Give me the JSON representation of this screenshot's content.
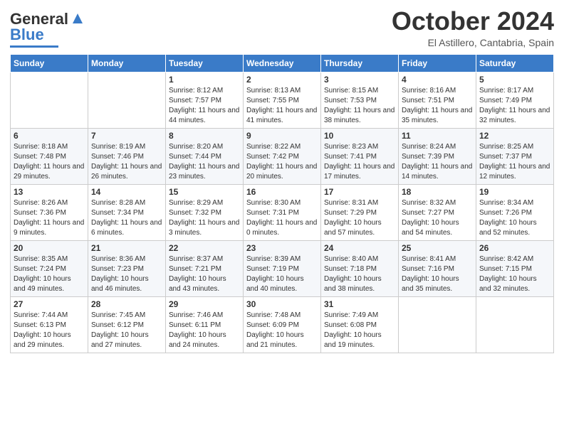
{
  "logo": {
    "line1": "General",
    "line2": "Blue"
  },
  "header": {
    "month": "October 2024",
    "location": "El Astillero, Cantabria, Spain"
  },
  "weekdays": [
    "Sunday",
    "Monday",
    "Tuesday",
    "Wednesday",
    "Thursday",
    "Friday",
    "Saturday"
  ],
  "weeks": [
    [
      {
        "day": "",
        "sunrise": "",
        "sunset": "",
        "daylight": ""
      },
      {
        "day": "",
        "sunrise": "",
        "sunset": "",
        "daylight": ""
      },
      {
        "day": "1",
        "sunrise": "Sunrise: 8:12 AM",
        "sunset": "Sunset: 7:57 PM",
        "daylight": "Daylight: 11 hours and 44 minutes."
      },
      {
        "day": "2",
        "sunrise": "Sunrise: 8:13 AM",
        "sunset": "Sunset: 7:55 PM",
        "daylight": "Daylight: 11 hours and 41 minutes."
      },
      {
        "day": "3",
        "sunrise": "Sunrise: 8:15 AM",
        "sunset": "Sunset: 7:53 PM",
        "daylight": "Daylight: 11 hours and 38 minutes."
      },
      {
        "day": "4",
        "sunrise": "Sunrise: 8:16 AM",
        "sunset": "Sunset: 7:51 PM",
        "daylight": "Daylight: 11 hours and 35 minutes."
      },
      {
        "day": "5",
        "sunrise": "Sunrise: 8:17 AM",
        "sunset": "Sunset: 7:49 PM",
        "daylight": "Daylight: 11 hours and 32 minutes."
      }
    ],
    [
      {
        "day": "6",
        "sunrise": "Sunrise: 8:18 AM",
        "sunset": "Sunset: 7:48 PM",
        "daylight": "Daylight: 11 hours and 29 minutes."
      },
      {
        "day": "7",
        "sunrise": "Sunrise: 8:19 AM",
        "sunset": "Sunset: 7:46 PM",
        "daylight": "Daylight: 11 hours and 26 minutes."
      },
      {
        "day": "8",
        "sunrise": "Sunrise: 8:20 AM",
        "sunset": "Sunset: 7:44 PM",
        "daylight": "Daylight: 11 hours and 23 minutes."
      },
      {
        "day": "9",
        "sunrise": "Sunrise: 8:22 AM",
        "sunset": "Sunset: 7:42 PM",
        "daylight": "Daylight: 11 hours and 20 minutes."
      },
      {
        "day": "10",
        "sunrise": "Sunrise: 8:23 AM",
        "sunset": "Sunset: 7:41 PM",
        "daylight": "Daylight: 11 hours and 17 minutes."
      },
      {
        "day": "11",
        "sunrise": "Sunrise: 8:24 AM",
        "sunset": "Sunset: 7:39 PM",
        "daylight": "Daylight: 11 hours and 14 minutes."
      },
      {
        "day": "12",
        "sunrise": "Sunrise: 8:25 AM",
        "sunset": "Sunset: 7:37 PM",
        "daylight": "Daylight: 11 hours and 12 minutes."
      }
    ],
    [
      {
        "day": "13",
        "sunrise": "Sunrise: 8:26 AM",
        "sunset": "Sunset: 7:36 PM",
        "daylight": "Daylight: 11 hours and 9 minutes."
      },
      {
        "day": "14",
        "sunrise": "Sunrise: 8:28 AM",
        "sunset": "Sunset: 7:34 PM",
        "daylight": "Daylight: 11 hours and 6 minutes."
      },
      {
        "day": "15",
        "sunrise": "Sunrise: 8:29 AM",
        "sunset": "Sunset: 7:32 PM",
        "daylight": "Daylight: 11 hours and 3 minutes."
      },
      {
        "day": "16",
        "sunrise": "Sunrise: 8:30 AM",
        "sunset": "Sunset: 7:31 PM",
        "daylight": "Daylight: 11 hours and 0 minutes."
      },
      {
        "day": "17",
        "sunrise": "Sunrise: 8:31 AM",
        "sunset": "Sunset: 7:29 PM",
        "daylight": "Daylight: 10 hours and 57 minutes."
      },
      {
        "day": "18",
        "sunrise": "Sunrise: 8:32 AM",
        "sunset": "Sunset: 7:27 PM",
        "daylight": "Daylight: 10 hours and 54 minutes."
      },
      {
        "day": "19",
        "sunrise": "Sunrise: 8:34 AM",
        "sunset": "Sunset: 7:26 PM",
        "daylight": "Daylight: 10 hours and 52 minutes."
      }
    ],
    [
      {
        "day": "20",
        "sunrise": "Sunrise: 8:35 AM",
        "sunset": "Sunset: 7:24 PM",
        "daylight": "Daylight: 10 hours and 49 minutes."
      },
      {
        "day": "21",
        "sunrise": "Sunrise: 8:36 AM",
        "sunset": "Sunset: 7:23 PM",
        "daylight": "Daylight: 10 hours and 46 minutes."
      },
      {
        "day": "22",
        "sunrise": "Sunrise: 8:37 AM",
        "sunset": "Sunset: 7:21 PM",
        "daylight": "Daylight: 10 hours and 43 minutes."
      },
      {
        "day": "23",
        "sunrise": "Sunrise: 8:39 AM",
        "sunset": "Sunset: 7:19 PM",
        "daylight": "Daylight: 10 hours and 40 minutes."
      },
      {
        "day": "24",
        "sunrise": "Sunrise: 8:40 AM",
        "sunset": "Sunset: 7:18 PM",
        "daylight": "Daylight: 10 hours and 38 minutes."
      },
      {
        "day": "25",
        "sunrise": "Sunrise: 8:41 AM",
        "sunset": "Sunset: 7:16 PM",
        "daylight": "Daylight: 10 hours and 35 minutes."
      },
      {
        "day": "26",
        "sunrise": "Sunrise: 8:42 AM",
        "sunset": "Sunset: 7:15 PM",
        "daylight": "Daylight: 10 hours and 32 minutes."
      }
    ],
    [
      {
        "day": "27",
        "sunrise": "Sunrise: 7:44 AM",
        "sunset": "Sunset: 6:13 PM",
        "daylight": "Daylight: 10 hours and 29 minutes."
      },
      {
        "day": "28",
        "sunrise": "Sunrise: 7:45 AM",
        "sunset": "Sunset: 6:12 PM",
        "daylight": "Daylight: 10 hours and 27 minutes."
      },
      {
        "day": "29",
        "sunrise": "Sunrise: 7:46 AM",
        "sunset": "Sunset: 6:11 PM",
        "daylight": "Daylight: 10 hours and 24 minutes."
      },
      {
        "day": "30",
        "sunrise": "Sunrise: 7:48 AM",
        "sunset": "Sunset: 6:09 PM",
        "daylight": "Daylight: 10 hours and 21 minutes."
      },
      {
        "day": "31",
        "sunrise": "Sunrise: 7:49 AM",
        "sunset": "Sunset: 6:08 PM",
        "daylight": "Daylight: 10 hours and 19 minutes."
      },
      {
        "day": "",
        "sunrise": "",
        "sunset": "",
        "daylight": ""
      },
      {
        "day": "",
        "sunrise": "",
        "sunset": "",
        "daylight": ""
      }
    ]
  ]
}
